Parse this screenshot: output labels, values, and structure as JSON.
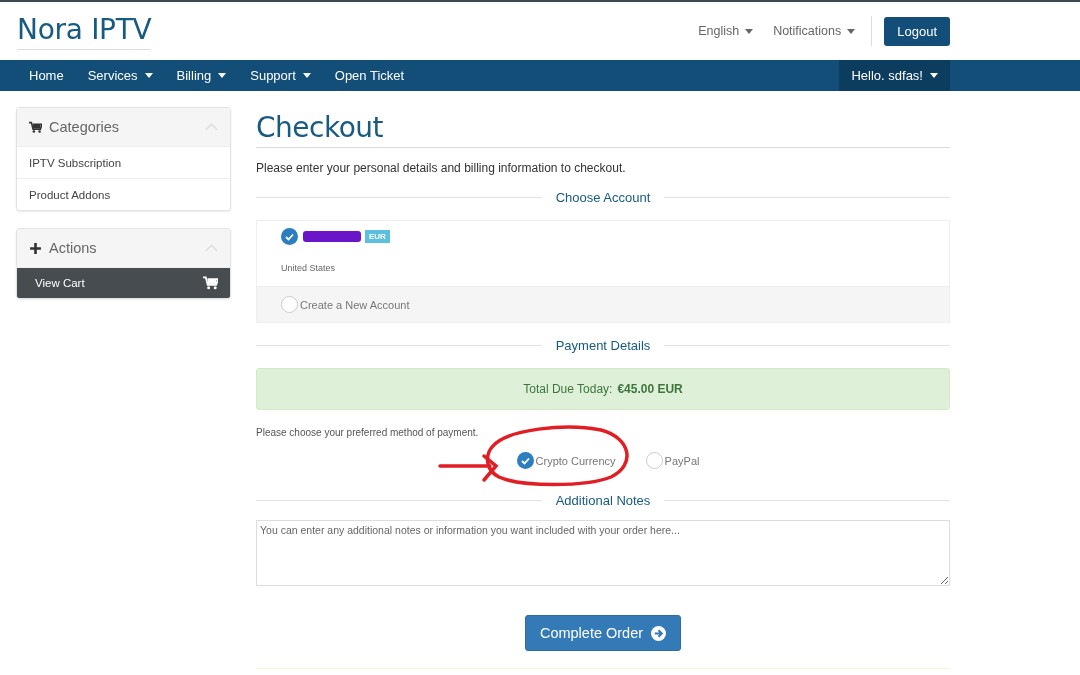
{
  "brand": "Nora IPTV",
  "top_links": [
    {
      "label": "English",
      "dropdown": true
    },
    {
      "label": "Notifications",
      "dropdown": true
    }
  ],
  "logout": "Logout",
  "nav": [
    {
      "label": "Home",
      "dropdown": false
    },
    {
      "label": "Services",
      "dropdown": true
    },
    {
      "label": "Billing",
      "dropdown": true
    },
    {
      "label": "Support",
      "dropdown": true
    },
    {
      "label": "Open Ticket",
      "dropdown": false
    }
  ],
  "user_menu": {
    "label": "Hello. sdfas!",
    "dropdown": true
  },
  "sidebar": [
    {
      "title": "Categories",
      "items": [
        {
          "label": "IPTV Subscription",
          "selected": false
        },
        {
          "label": "Product Addons",
          "selected": false
        }
      ]
    },
    {
      "title": "Actions",
      "items": [
        {
          "label": "View Cart",
          "selected": true
        }
      ]
    }
  ],
  "page": {
    "title": "Checkout",
    "intro": "Please enter your personal details and billing information to checkout."
  },
  "account_section": {
    "heading": "Choose Account",
    "accounts": [
      {
        "kind": "existing",
        "selected": true,
        "currency": "EUR",
        "country": "United States"
      },
      {
        "kind": "new",
        "selected": false,
        "label": "Create a New Account"
      }
    ]
  },
  "payment_section": {
    "heading": "Payment Details",
    "total_label": "Total Due Today:",
    "total": "€45.00 EUR",
    "prompt": "Please choose your preferred method of payment.",
    "methods": [
      {
        "label": "Crypto Currency",
        "selected": true
      },
      {
        "label": "PayPal",
        "selected": false
      }
    ]
  },
  "notes_section": {
    "heading": "Additional Notes",
    "placeholder": "You can enter any additional notes or information you want included with your order here..."
  },
  "submit": "Complete Order"
}
